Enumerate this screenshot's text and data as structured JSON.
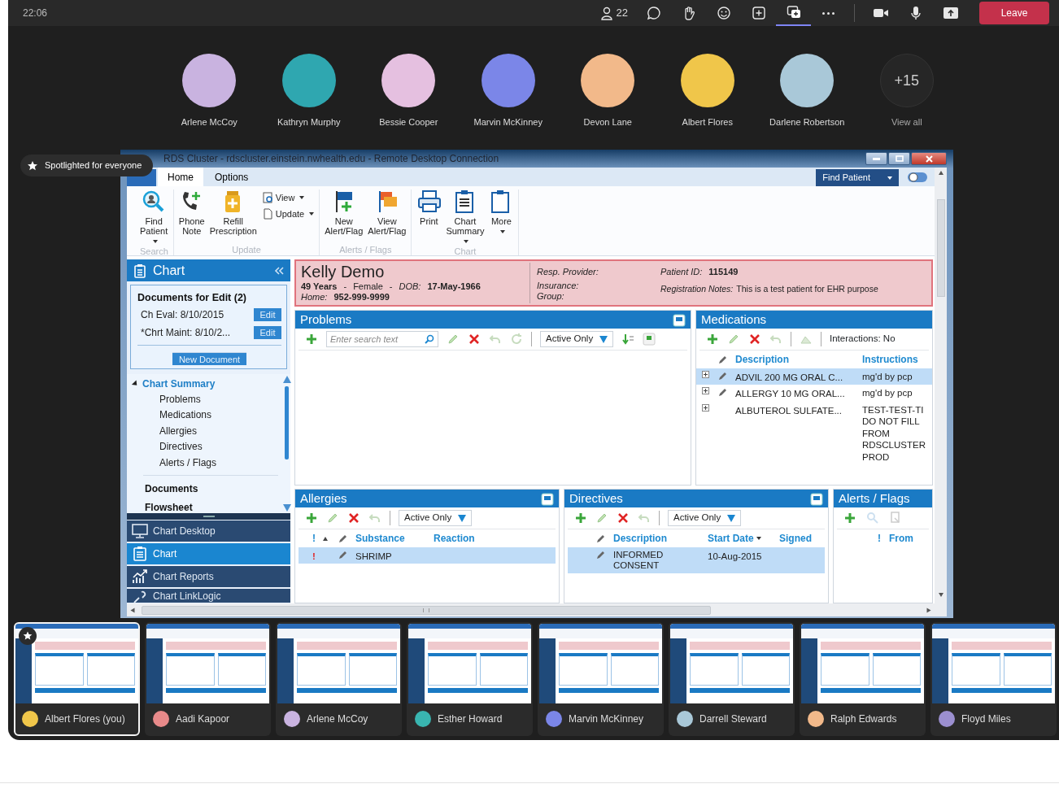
{
  "meeting": {
    "time": "22:06",
    "participant_count": "22",
    "controls": [
      {
        "selected": false
      },
      {
        "selected": false
      },
      {
        "selected": false
      },
      {
        "selected": false
      },
      {
        "selected": true
      },
      {
        "selected": false
      }
    ],
    "leave_button": "Leave"
  },
  "participants": [
    {
      "name": "Arlene McCoy",
      "color": "#c9b3e0"
    },
    {
      "name": "Kathryn Murphy",
      "color": "#2fa7b0"
    },
    {
      "name": "Bessie Cooper",
      "color": "#e5c0e0"
    },
    {
      "name": "Marvin McKinney",
      "color": "#7b86e8"
    },
    {
      "name": "Devon Lane",
      "color": "#f2b98a"
    },
    {
      "name": "Albert Flores",
      "color": "#f0c64a"
    },
    {
      "name": "Darlene Robertson",
      "color": "#a9c8d8"
    }
  ],
  "more_participants": {
    "count": "+15",
    "label": "View all"
  },
  "spotlight_badge": "Spotlighted for everyone",
  "remote_window": {
    "title": "RDS Cluster - rdscluster.einstein.nwhealth.edu - Remote Desktop Connection",
    "tabs": [
      {
        "label": "Home",
        "selected": true
      },
      {
        "label": "Options",
        "selected": false
      }
    ],
    "find_patient_button": "Find Patient",
    "ribbon_groups": [
      {
        "label": "Search",
        "buttons": [
          {
            "kind": "large",
            "label": "Find Patient",
            "dropdown": true
          }
        ]
      },
      {
        "label": "Update",
        "buttons": [
          {
            "kind": "large",
            "label": "Phone Note",
            "dropdown": false
          },
          {
            "kind": "large",
            "label": "Refill Prescription",
            "dropdown": false
          },
          {
            "kind": "small",
            "label": "View",
            "dropdown": true
          },
          {
            "kind": "small",
            "label": "Update",
            "dropdown": true
          }
        ]
      },
      {
        "label": "Alerts / Flags",
        "buttons": [
          {
            "kind": "large",
            "label": "New Alert/Flag",
            "dropdown": false
          },
          {
            "kind": "large",
            "label": "View Alert/Flag",
            "dropdown": false
          }
        ]
      },
      {
        "label": "Chart",
        "buttons": [
          {
            "kind": "large",
            "label": "Print",
            "dropdown": false
          },
          {
            "kind": "large",
            "label": "Chart Summary",
            "dropdown": true
          },
          {
            "kind": "large",
            "label": "More",
            "dropdown": true
          }
        ]
      }
    ],
    "chart_panel": {
      "title": "Chart",
      "documents": {
        "title": "Documents for Edit (2)",
        "items": [
          {
            "label": "Ch Eval: 8/10/2015",
            "button": "Edit"
          },
          {
            "label": "*Chrt Maint: 8/10/2...",
            "button": "Edit"
          }
        ],
        "new_button": "New Document"
      },
      "tree": [
        {
          "label": "Chart Summary",
          "children": [
            {
              "label": "Problems"
            },
            {
              "label": "Medications"
            },
            {
              "label": "Allergies"
            },
            {
              "label": "Directives"
            },
            {
              "label": "Alerts / Flags"
            }
          ]
        },
        {
          "label": "Documents"
        },
        {
          "label": "Flowsheet"
        }
      ],
      "nav": [
        {
          "label": "Chart Desktop",
          "selected": false
        },
        {
          "label": "Chart",
          "selected": true
        },
        {
          "label": "Chart Reports",
          "selected": false
        },
        {
          "label": "Chart LinkLogic",
          "selected": false
        }
      ]
    },
    "patient": {
      "name": "Kelly Demo",
      "age": "49 Years",
      "separator_1": "-",
      "sex": "Female",
      "separator_2": "-",
      "dob_label": "DOB:",
      "dob": "17-May-1966",
      "home_label": "Home:",
      "home": "952-999-9999",
      "resp_provider_label": "Resp. Provider:",
      "insurance_label": "Insurance:",
      "group_label": "Group:",
      "patient_id_label": "Patient ID:",
      "patient_id": "115149",
      "notes_label": "Registration Notes:",
      "notes": "This is a test patient for EHR purpose"
    },
    "problems": {
      "title": "Problems",
      "search_placeholder": "Enter search text",
      "filter": "Active Only"
    },
    "medications": {
      "title": "Medications",
      "interactions": "Interactions: No",
      "columns": [
        "Description",
        "Instructions"
      ],
      "rows": [
        {
          "description": "ADVIL 200 MG ORAL C...",
          "instructions": "mg'd by pcp",
          "editable": true,
          "selected": true
        },
        {
          "description": "ALLERGY 10 MG ORAL...",
          "instructions": "mg'd by pcp",
          "editable": true,
          "selected": false
        },
        {
          "description": "ALBUTEROL SULFATE...",
          "instructions": "TEST-TEST-TI\nDO NOT FILL\nFROM\nRDSCLUSTER\nPROD",
          "editable": false,
          "selected": false
        }
      ]
    },
    "allergies": {
      "title": "Allergies",
      "filter": "Active Only",
      "columns": [
        "!",
        "Substance",
        "Reaction"
      ],
      "rows": [
        {
          "severity": "!",
          "substance": "SHRIMP",
          "selected": true
        }
      ]
    },
    "directives": {
      "title": "Directives",
      "filter": "Active Only",
      "columns": [
        "Description",
        "Start Date",
        "Signed"
      ],
      "rows": [
        {
          "description": "INFORMED CONSENT",
          "start_date": "10-Aug-2015",
          "selected": true
        }
      ]
    },
    "alerts": {
      "title": "Alerts / Flags",
      "columns": [
        "!",
        "From"
      ]
    }
  },
  "thumbnails": [
    {
      "name": "Albert Flores (you)",
      "color": "#f0c64a",
      "selected": true,
      "spotlighted": true
    },
    {
      "name": "Aadi Kapoor",
      "color": "#e88a8a",
      "selected": false,
      "spotlighted": false
    },
    {
      "name": "Arlene McCoy",
      "color": "#c9b3e0",
      "selected": false,
      "spotlighted": false
    },
    {
      "name": "Esther Howard",
      "color": "#39b5b0",
      "selected": false,
      "spotlighted": false
    },
    {
      "name": "Marvin McKinney",
      "color": "#7b86e8",
      "selected": false,
      "spotlighted": false
    },
    {
      "name": "Darrell Steward",
      "color": "#a9c8d8",
      "selected": false,
      "spotlighted": false
    },
    {
      "name": "Ralph Edwards",
      "color": "#f2b98a",
      "selected": false,
      "spotlighted": false
    },
    {
      "name": "Floyd Miles",
      "color": "#9b8fd0",
      "selected": false,
      "spotlighted": false
    }
  ]
}
